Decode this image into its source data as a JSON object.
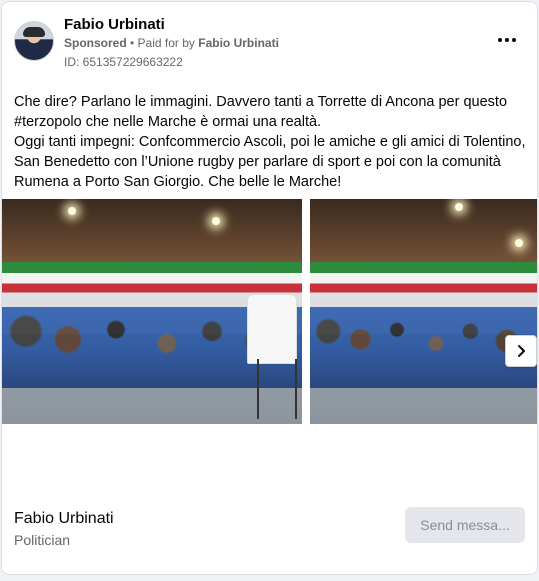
{
  "post": {
    "author": "Fabio Urbinati",
    "sponsored_label": "Sponsored",
    "separator": " • ",
    "paid_for_prefix": "Paid for by ",
    "paid_for_by": "Fabio Urbinati",
    "ad_id": "ID: 651357229663222",
    "more_icon": "more-horizontal-icon",
    "text_lines": [
      "Che dire? Parlano le immagini. Davvero tanti a Torrette di Ancona per questo",
      "#terzopolo che nelle Marche è ormai una realtà.",
      "Oggi tanti impegni: Confcommercio Ascoli, poi le amiche e gli amici di Tolentino,",
      "San Benedetto con l’Unione rugby per parlare di sport e poi con la comunità",
      "Rumena a Porto San Giorgio. Che belle le Marche!"
    ]
  },
  "carousel": {
    "next_icon": "chevron-right-icon",
    "photos": [
      {
        "name": "event-photo-1"
      },
      {
        "name": "event-photo-2"
      }
    ]
  },
  "footer": {
    "page_name": "Fabio Urbinati",
    "page_category": "Politician",
    "send_button_label": "Send messa..."
  },
  "colors": {
    "text_primary": "#050505",
    "text_secondary": "#65676b",
    "button_bg": "#e4e6eb",
    "card_bg": "#ffffff"
  }
}
